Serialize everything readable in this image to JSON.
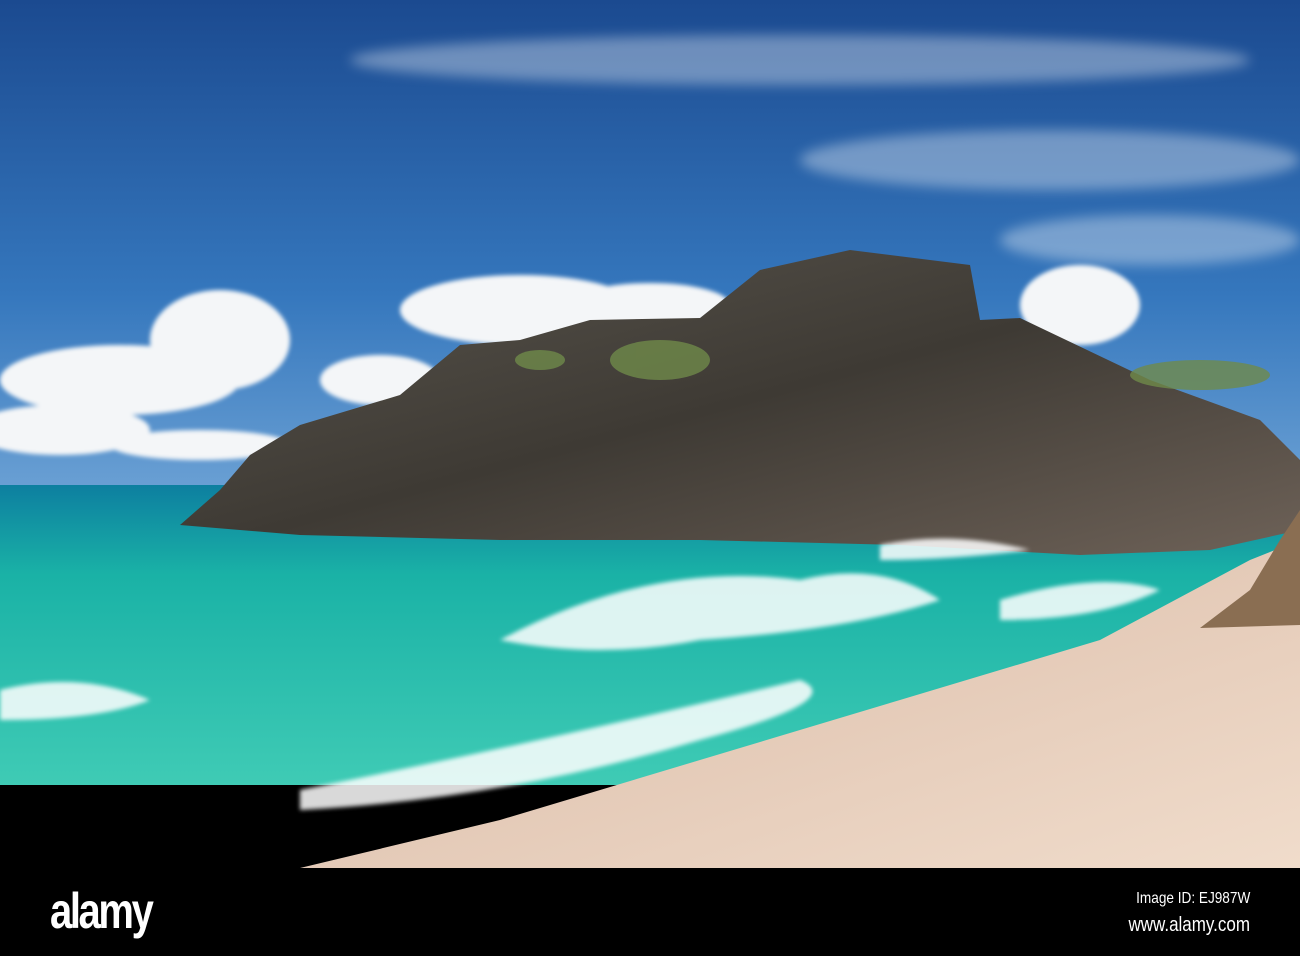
{
  "watermark": {
    "logo": "alamy",
    "image_id": "Image ID: EJ987W",
    "url": "www.alamy.com"
  },
  "colors": {
    "sky_top": "#1d4f95",
    "sky_bottom": "#4a86c4",
    "sea": "#1fb5a8",
    "sand": "#e8cdb8",
    "rock": "#4a4640"
  }
}
